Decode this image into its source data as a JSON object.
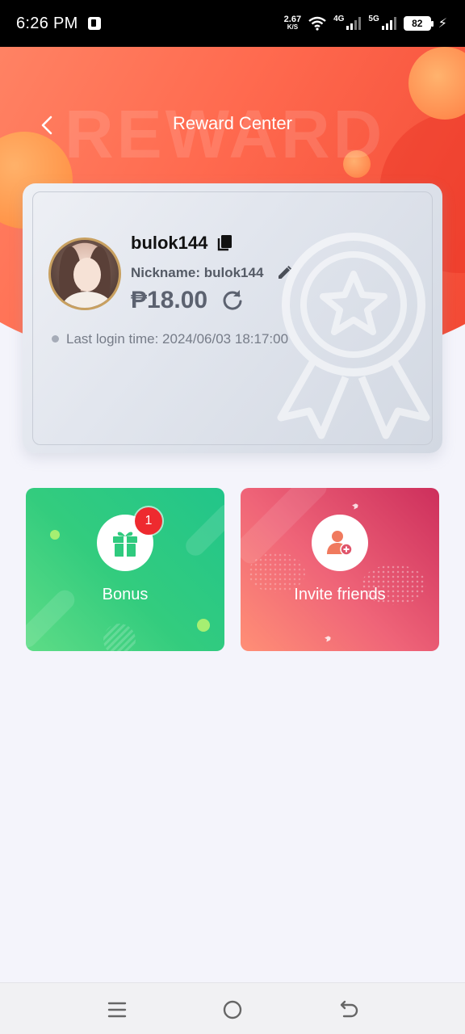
{
  "status_bar": {
    "time": "6:26 PM",
    "speed_value": "2.67",
    "speed_unit": "K/S",
    "net1": "4G",
    "net2": "5G",
    "battery": "82"
  },
  "header": {
    "title": "Reward Center",
    "watermark": "REWARD"
  },
  "profile": {
    "username": "bulok144",
    "nickname": "Nickname: bulok144",
    "balance": "₱18.00",
    "last_login": "Last login time: 2024/06/03 18:17:00"
  },
  "tiles": [
    {
      "label": "Bonus",
      "badge": "1",
      "icon": "gift-icon"
    },
    {
      "label": "Invite friends",
      "icon": "add-user-icon"
    }
  ],
  "colors": {
    "header": "#ff6a4f",
    "bonus_tile": "#33cc7e",
    "invite_tile": "#ef6478",
    "badge": "#ee2a2f"
  },
  "navbar": {
    "icons": [
      "menu-icon",
      "home-icon",
      "back-icon"
    ]
  }
}
